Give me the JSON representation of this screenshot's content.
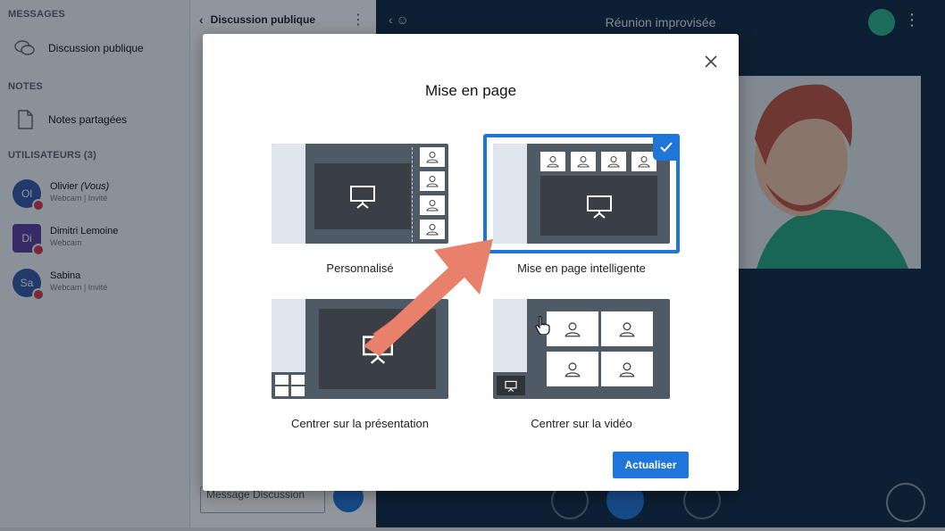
{
  "sidebar": {
    "messages_header": "MESSAGES",
    "public_chat": "Discussion publique",
    "notes_header": "NOTES",
    "shared_notes": "Notes partagées",
    "users_header": "UTILISATEURS (3)",
    "users": [
      {
        "initials": "Ol",
        "name": "Olivier",
        "you_tag": "(Vous)",
        "status": "Webcam | Invité",
        "color": "#3557a8"
      },
      {
        "initials": "Di",
        "name": "Dimitri Lemoine",
        "you_tag": "",
        "status": "Webcam",
        "color": "#5b3d9e"
      },
      {
        "initials": "Sa",
        "name": "Sabina",
        "you_tag": "",
        "status": "Webcam | Invité",
        "color": "#3557a8"
      }
    ]
  },
  "chat": {
    "title": "Discussion publique",
    "placeholder": "Message Discussion"
  },
  "meeting": {
    "title": "Réunion improvisée"
  },
  "dialog": {
    "title": "Mise en page",
    "options": [
      {
        "label": "Personnalisé",
        "selected": false
      },
      {
        "label": "Mise en page intelligente",
        "selected": true
      },
      {
        "label": "Centrer sur la présentation",
        "selected": false
      },
      {
        "label": "Centrer sur la vidéo",
        "selected": false
      }
    ],
    "update_label": "Actualiser"
  },
  "colors": {
    "accent": "#1f75d8",
    "arrow": "#e8806c",
    "thumb_bg": "#4e5a66",
    "muted_badge": "#d8374a"
  }
}
